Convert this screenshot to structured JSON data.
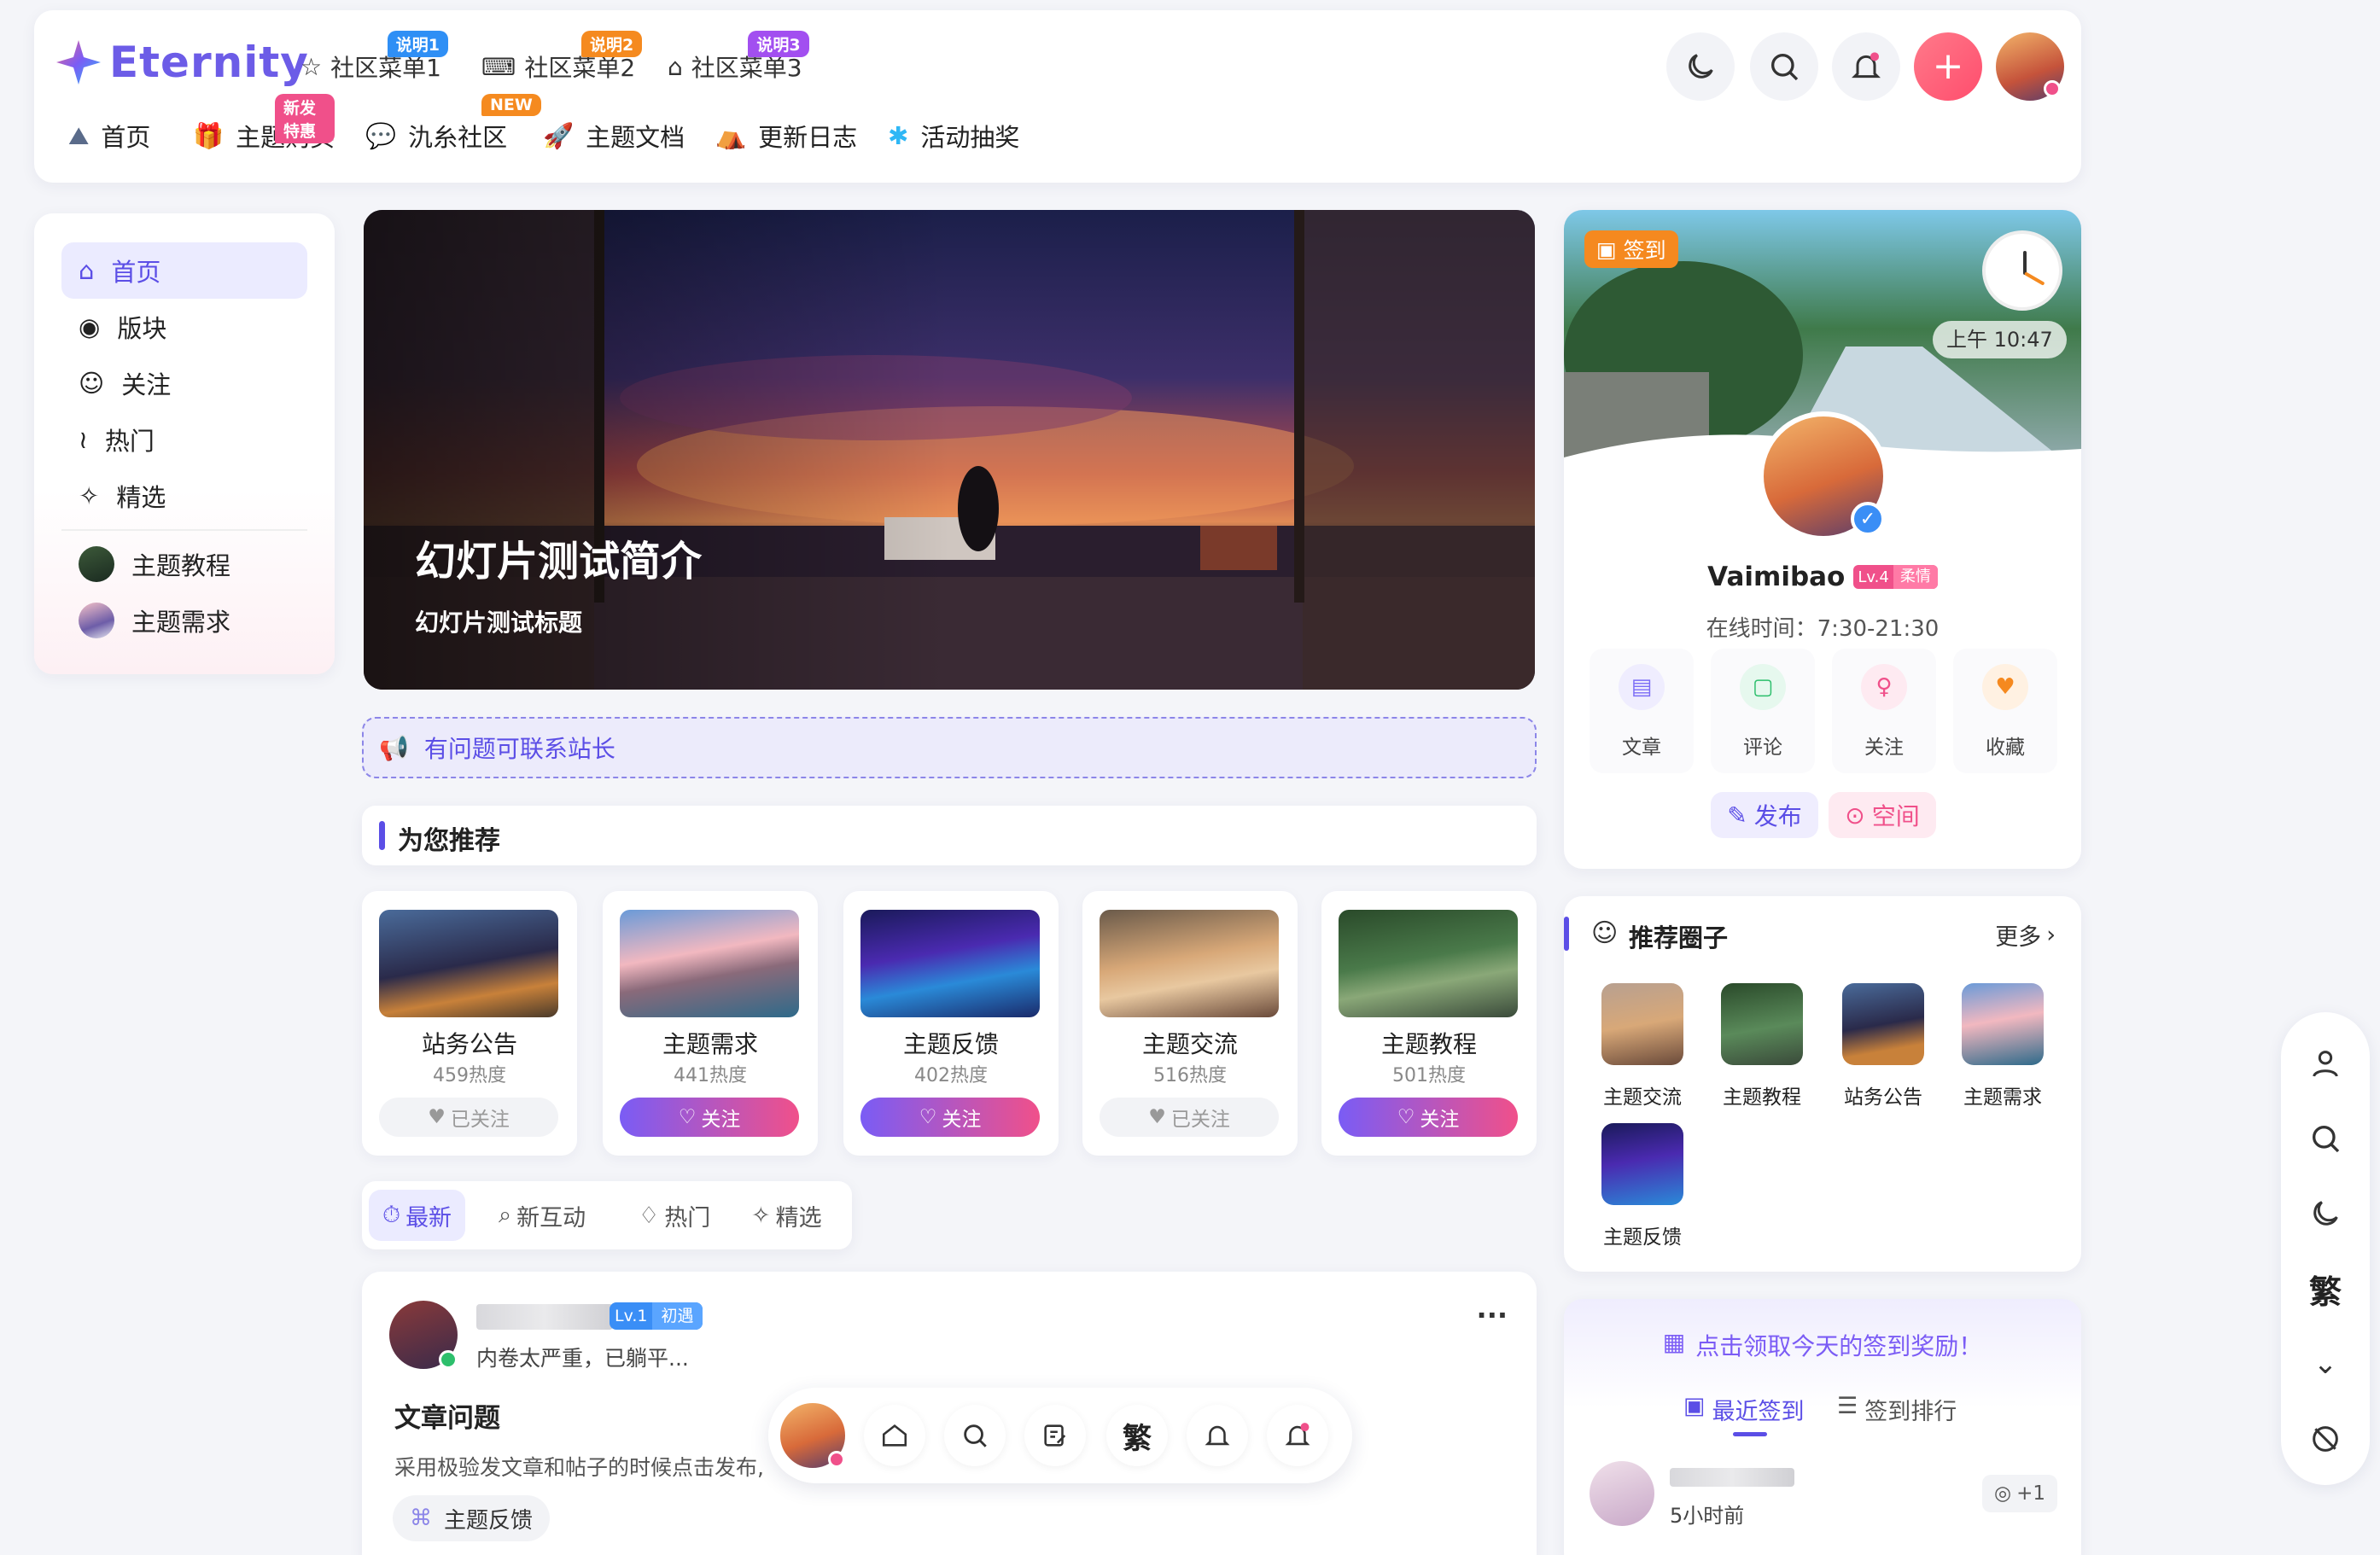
{
  "header": {
    "logo_text": "Eternity",
    "menus": [
      {
        "label": "社区菜单1",
        "badge": "说明1",
        "badge_color": "#2f8ff5"
      },
      {
        "label": "社区菜单2",
        "badge": "说明2",
        "badge_color": "#f58a1f"
      },
      {
        "label": "社区菜单3",
        "badge": "说明3",
        "badge_color": "#a24ff0"
      }
    ],
    "nav": [
      {
        "label": "首页",
        "icon": "home-icon"
      },
      {
        "label": "主题购买",
        "icon": "gift-icon",
        "badge": "新发特惠"
      },
      {
        "label": "氿糸社区",
        "icon": "chat-bubble-icon",
        "badge": "NEW"
      },
      {
        "label": "主题文档",
        "icon": "rocket-icon"
      },
      {
        "label": "更新日志",
        "icon": "tent-icon"
      },
      {
        "label": "活动抽奖",
        "icon": "pinwheel-icon"
      }
    ]
  },
  "sidebar": {
    "items": [
      {
        "label": "首页",
        "icon": "home-icon",
        "active": true
      },
      {
        "label": "版块",
        "icon": "grid-circle-icon"
      },
      {
        "label": "关注",
        "icon": "smile-circle-icon"
      },
      {
        "label": "热门",
        "icon": "flame-icon"
      },
      {
        "label": "精选",
        "icon": "sparkle-icon"
      }
    ],
    "circles": [
      {
        "label": "主题教程"
      },
      {
        "label": "主题需求"
      }
    ]
  },
  "banner": {
    "title": "幻灯片测试简介",
    "subtitle": "幻灯片测试标题"
  },
  "notice": {
    "text": "有问题可联系站长"
  },
  "recommend": {
    "heading": "为您推荐",
    "items": [
      {
        "title": "站务公告",
        "heat": "459热度",
        "button": "已关注",
        "followed": true
      },
      {
        "title": "主题需求",
        "heat": "441热度",
        "button": "关注",
        "followed": false
      },
      {
        "title": "主题反馈",
        "heat": "402热度",
        "button": "关注",
        "followed": false
      },
      {
        "title": "主题交流",
        "heat": "516热度",
        "button": "已关注",
        "followed": true
      },
      {
        "title": "主题教程",
        "heat": "501热度",
        "button": "关注",
        "followed": false
      }
    ]
  },
  "feed_tabs": [
    {
      "label": "最新",
      "icon": "clock-icon",
      "active": true
    },
    {
      "label": "新互动",
      "icon": "chat-icon"
    },
    {
      "label": "热门",
      "icon": "flame-icon"
    },
    {
      "label": "精选",
      "icon": "sparkle-icon"
    }
  ],
  "post": {
    "level": "Lv.1",
    "level_name": "初遇",
    "status": "内卷太严重，已躺平...",
    "title": "文章问题",
    "excerpt": "采用极验发文章和帖子的时候点击发布,",
    "tag": "主题反馈",
    "more": "···"
  },
  "profile": {
    "checkin": "签到",
    "time": "上午 10:47",
    "name": "Vaimibao",
    "level": "Lv.4",
    "level_name": "柔情",
    "online": "在线时间：7:30-21:30",
    "stats": [
      {
        "label": "文章",
        "icon": "document-icon",
        "color": "#7b6cf6"
      },
      {
        "label": "评论",
        "icon": "comment-icon",
        "color": "#2dbf6c"
      },
      {
        "label": "关注",
        "icon": "user-add-icon",
        "color": "#f0508a"
      },
      {
        "label": "收藏",
        "icon": "heart-icon",
        "color": "#f5891f"
      }
    ],
    "publish": "发布",
    "space": "空间"
  },
  "circles": {
    "heading": "推荐圈子",
    "more": "更多",
    "items": [
      {
        "label": "主题交流"
      },
      {
        "label": "主题教程"
      },
      {
        "label": "站务公告"
      },
      {
        "label": "主题需求"
      },
      {
        "label": "主题反馈"
      }
    ]
  },
  "signin": {
    "prompt": "点击领取今天的签到奖励！",
    "tab_recent": "最近签到",
    "tab_rank": "签到排行",
    "time_ago": "5小时前",
    "points": "+1"
  },
  "rail": {
    "trad": "繁"
  },
  "dock": {
    "trad": "繁"
  },
  "colors": {
    "accent": "#6c5ce7",
    "pink": "#f0508a",
    "bg": "#f4f5f9"
  }
}
